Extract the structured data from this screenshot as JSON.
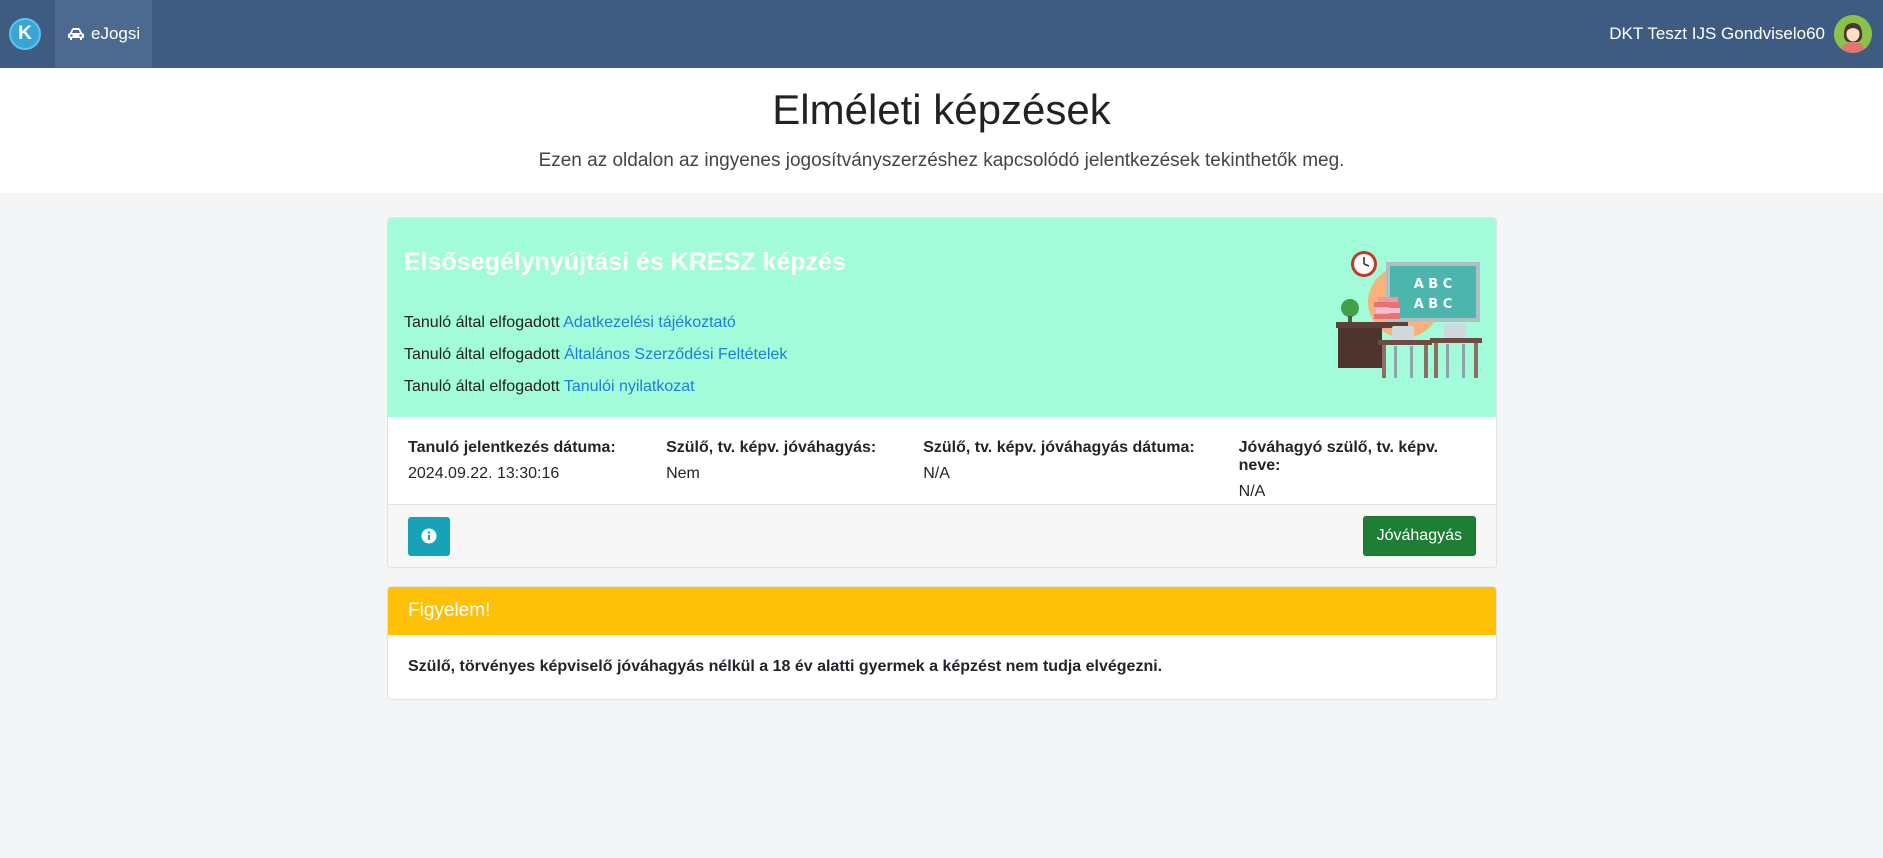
{
  "navbar": {
    "logo_letter": "K",
    "nav_label": "eJogsi",
    "user_name": "DKT Teszt IJS Gondviselo60"
  },
  "header": {
    "title": "Elméleti képzések",
    "subtitle": "Ezen az oldalon az ingyenes jogosítványszerzéshez kapcsolódó jelentkezések tekinthetők meg."
  },
  "course_card": {
    "title": "Elsősegélynyújtási és KRESZ képzés",
    "accepted_prefix": "Tanuló által elfogadott",
    "links": [
      "Adatkezelési tájékoztató",
      "Általános Szerződési Feltételek",
      "Tanulói nyilatkozat"
    ],
    "illustration_text": [
      "A B C",
      "A B C"
    ],
    "fields": [
      {
        "label": "Tanuló jelentkezés dátuma:",
        "value": "2024.09.22. 13:30:16"
      },
      {
        "label": "Szülő, tv. képv. jóváhagyás:",
        "value": "Nem"
      },
      {
        "label": "Szülő, tv. képv. jóváhagyás dátuma:",
        "value": "N/A"
      },
      {
        "label": "Jóváhagyó szülő, tv. képv. neve:",
        "value": "N/A"
      }
    ],
    "approve_label": "Jóváhagyás"
  },
  "alert": {
    "title": "Figyelem!",
    "message": "Szülő, törvényes képviselő jóváhagyás nélkül a 18 év alatti gyermek a képzést nem tudja elvégezni."
  },
  "colors": {
    "navbar": "#3e5c82",
    "banner": "#a2fcd9",
    "link": "#1a7fd8",
    "approve": "#1e7e34",
    "info_button": "#17a2b8",
    "warning": "#ffc107"
  },
  "icons": {
    "nav": "car-icon",
    "info_button": "info-circle-icon"
  }
}
